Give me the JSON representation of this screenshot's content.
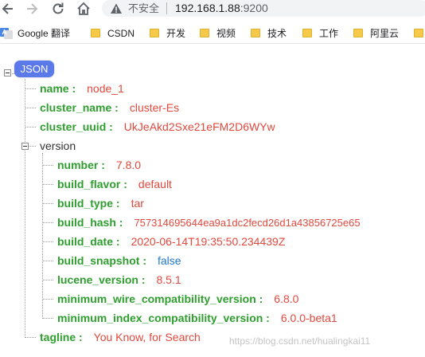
{
  "browser": {
    "security_label": "不安全",
    "url_host": "192.168.1.88",
    "url_port": ":9200"
  },
  "bookmarks": [
    {
      "label": "Google 翻译",
      "icon": "google-translate-icon"
    },
    {
      "label": "CSDN",
      "icon": "folder-icon"
    },
    {
      "label": "开发",
      "icon": "folder-icon"
    },
    {
      "label": "视频",
      "icon": "folder-icon"
    },
    {
      "label": "技术",
      "icon": "folder-icon"
    },
    {
      "label": "工作",
      "icon": "folder-icon"
    },
    {
      "label": "阿里云",
      "icon": "folder-icon"
    }
  ],
  "viewer": {
    "root_label": "JSON",
    "name": {
      "key": "name :",
      "value": "node_1"
    },
    "cluster_name": {
      "key": "cluster_name :",
      "value": "cluster-Es"
    },
    "cluster_uuid": {
      "key": "cluster_uuid :",
      "value": "UkJeAkd2Sxe21eFM2D6WYw"
    },
    "version_key": "version",
    "version": [
      {
        "key": "number :",
        "value": "7.8.0",
        "type": "string"
      },
      {
        "key": "build_flavor :",
        "value": "default",
        "type": "string"
      },
      {
        "key": "build_type :",
        "value": "tar",
        "type": "string"
      },
      {
        "key": "build_hash :",
        "value": "757314695644ea9a1dc2fecd26d1a43856725e65",
        "type": "string"
      },
      {
        "key": "build_date :",
        "value": "2020-06-14T19:35:50.234439Z",
        "type": "string"
      },
      {
        "key": "build_snapshot :",
        "value": "false",
        "type": "bool"
      },
      {
        "key": "lucene_version :",
        "value": "8.5.1",
        "type": "string"
      },
      {
        "key": "minimum_wire_compatibility_version :",
        "value": "6.8.0",
        "type": "string"
      },
      {
        "key": "minimum_index_compatibility_version :",
        "value": "6.0.0-beta1",
        "type": "string"
      }
    ],
    "tagline": {
      "key": "tagline :",
      "value": "You Know, for Search"
    }
  },
  "watermark": "https://blog.csdn.net/hualingkai11",
  "colors": {
    "key": "#2e9f2e",
    "string_value": "#e2483d",
    "bool_value": "#1e78c8",
    "root_badge": "#5b79e8"
  }
}
